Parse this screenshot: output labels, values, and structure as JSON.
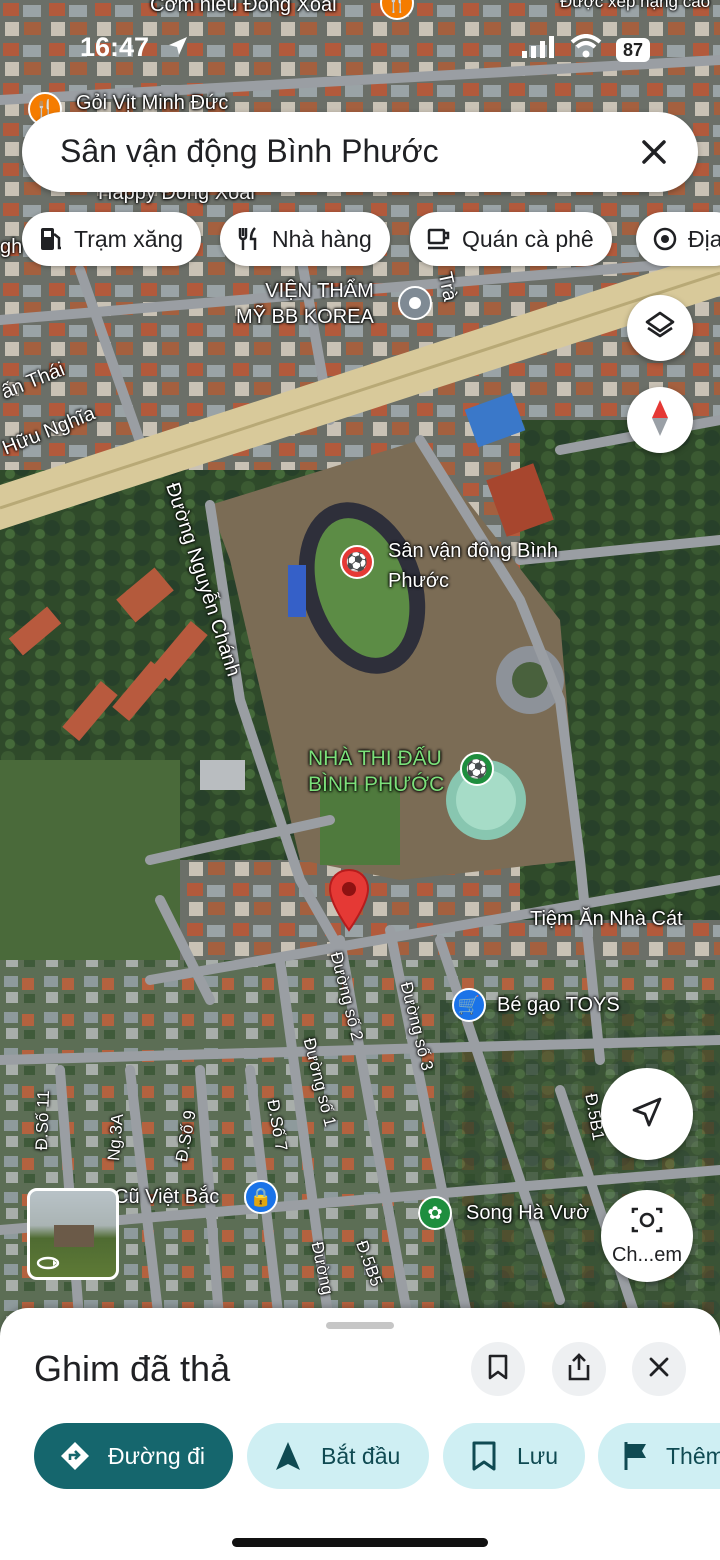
{
  "status_bar": {
    "time": "16:47",
    "battery": "87"
  },
  "search": {
    "query": "Sân vận động Bình Phước"
  },
  "chips": [
    {
      "label": "Trạm xăng",
      "icon": "gas-station-icon"
    },
    {
      "label": "Nhà hàng",
      "icon": "restaurant-icon"
    },
    {
      "label": "Quán cà phê",
      "icon": "coffee-icon"
    },
    {
      "label": "Địa",
      "icon": "attraction-icon"
    }
  ],
  "map": {
    "labels": {
      "top_restaurant": "Cơm niêu Đồng Xoài",
      "top_right": "Được xếp hạng cao",
      "goi_vit": "Gỏi Vịt Minh Đức",
      "happy": "Happy Đồng Xoài",
      "vien_tham_my": "VIỆN THẨM\nMỸ BB KOREA",
      "tra": "Trà",
      "tan_thai": "ấn Thái",
      "huu_nghia": "Hữu Nghĩa",
      "gh": "gh",
      "stadium": "Sân vận động Bình\nPhước",
      "road_nguyen_chanh": "Đường Nguyễn Chánh",
      "arena": "NHÀ THI ĐẤU\nBÌNH PHƯỚC",
      "tiem_an": "Tiệm Ăn Nhà Cát",
      "be_gao": "Bé gạo TOYS",
      "duong_so_2": "Đường số 2",
      "duong_so_3": "Đường số 3",
      "duong_so_1": "Đường số 1",
      "d_so_11": "Đ.Số 11",
      "ng_3a": "Ng.3A",
      "d_so_9": "Đ.Số 9",
      "d_so_7": "Đ.Số 7",
      "d_5b1": "Đ.5B1",
      "d_5b5": "Đ.5B5",
      "duong_bottom": "Đường",
      "cu_viet_bac": "Cũ Việt Bắc",
      "song_ha": "Song Hà Vườ"
    },
    "lens_label": "Ch...em"
  },
  "sheet": {
    "title": "Ghim đã thả",
    "actions": [
      {
        "label": "Đường đi",
        "icon": "directions-icon"
      },
      {
        "label": "Bắt đầu",
        "icon": "navigation-arrow-icon"
      },
      {
        "label": "Lưu",
        "icon": "bookmark-icon"
      },
      {
        "label": "Thêm",
        "icon": "flag-icon"
      }
    ]
  },
  "colors": {
    "primary_action": "#15666d",
    "secondary_action": "#cfeff3",
    "pin_red": "#e53935",
    "label_green": "#7ce07a"
  }
}
